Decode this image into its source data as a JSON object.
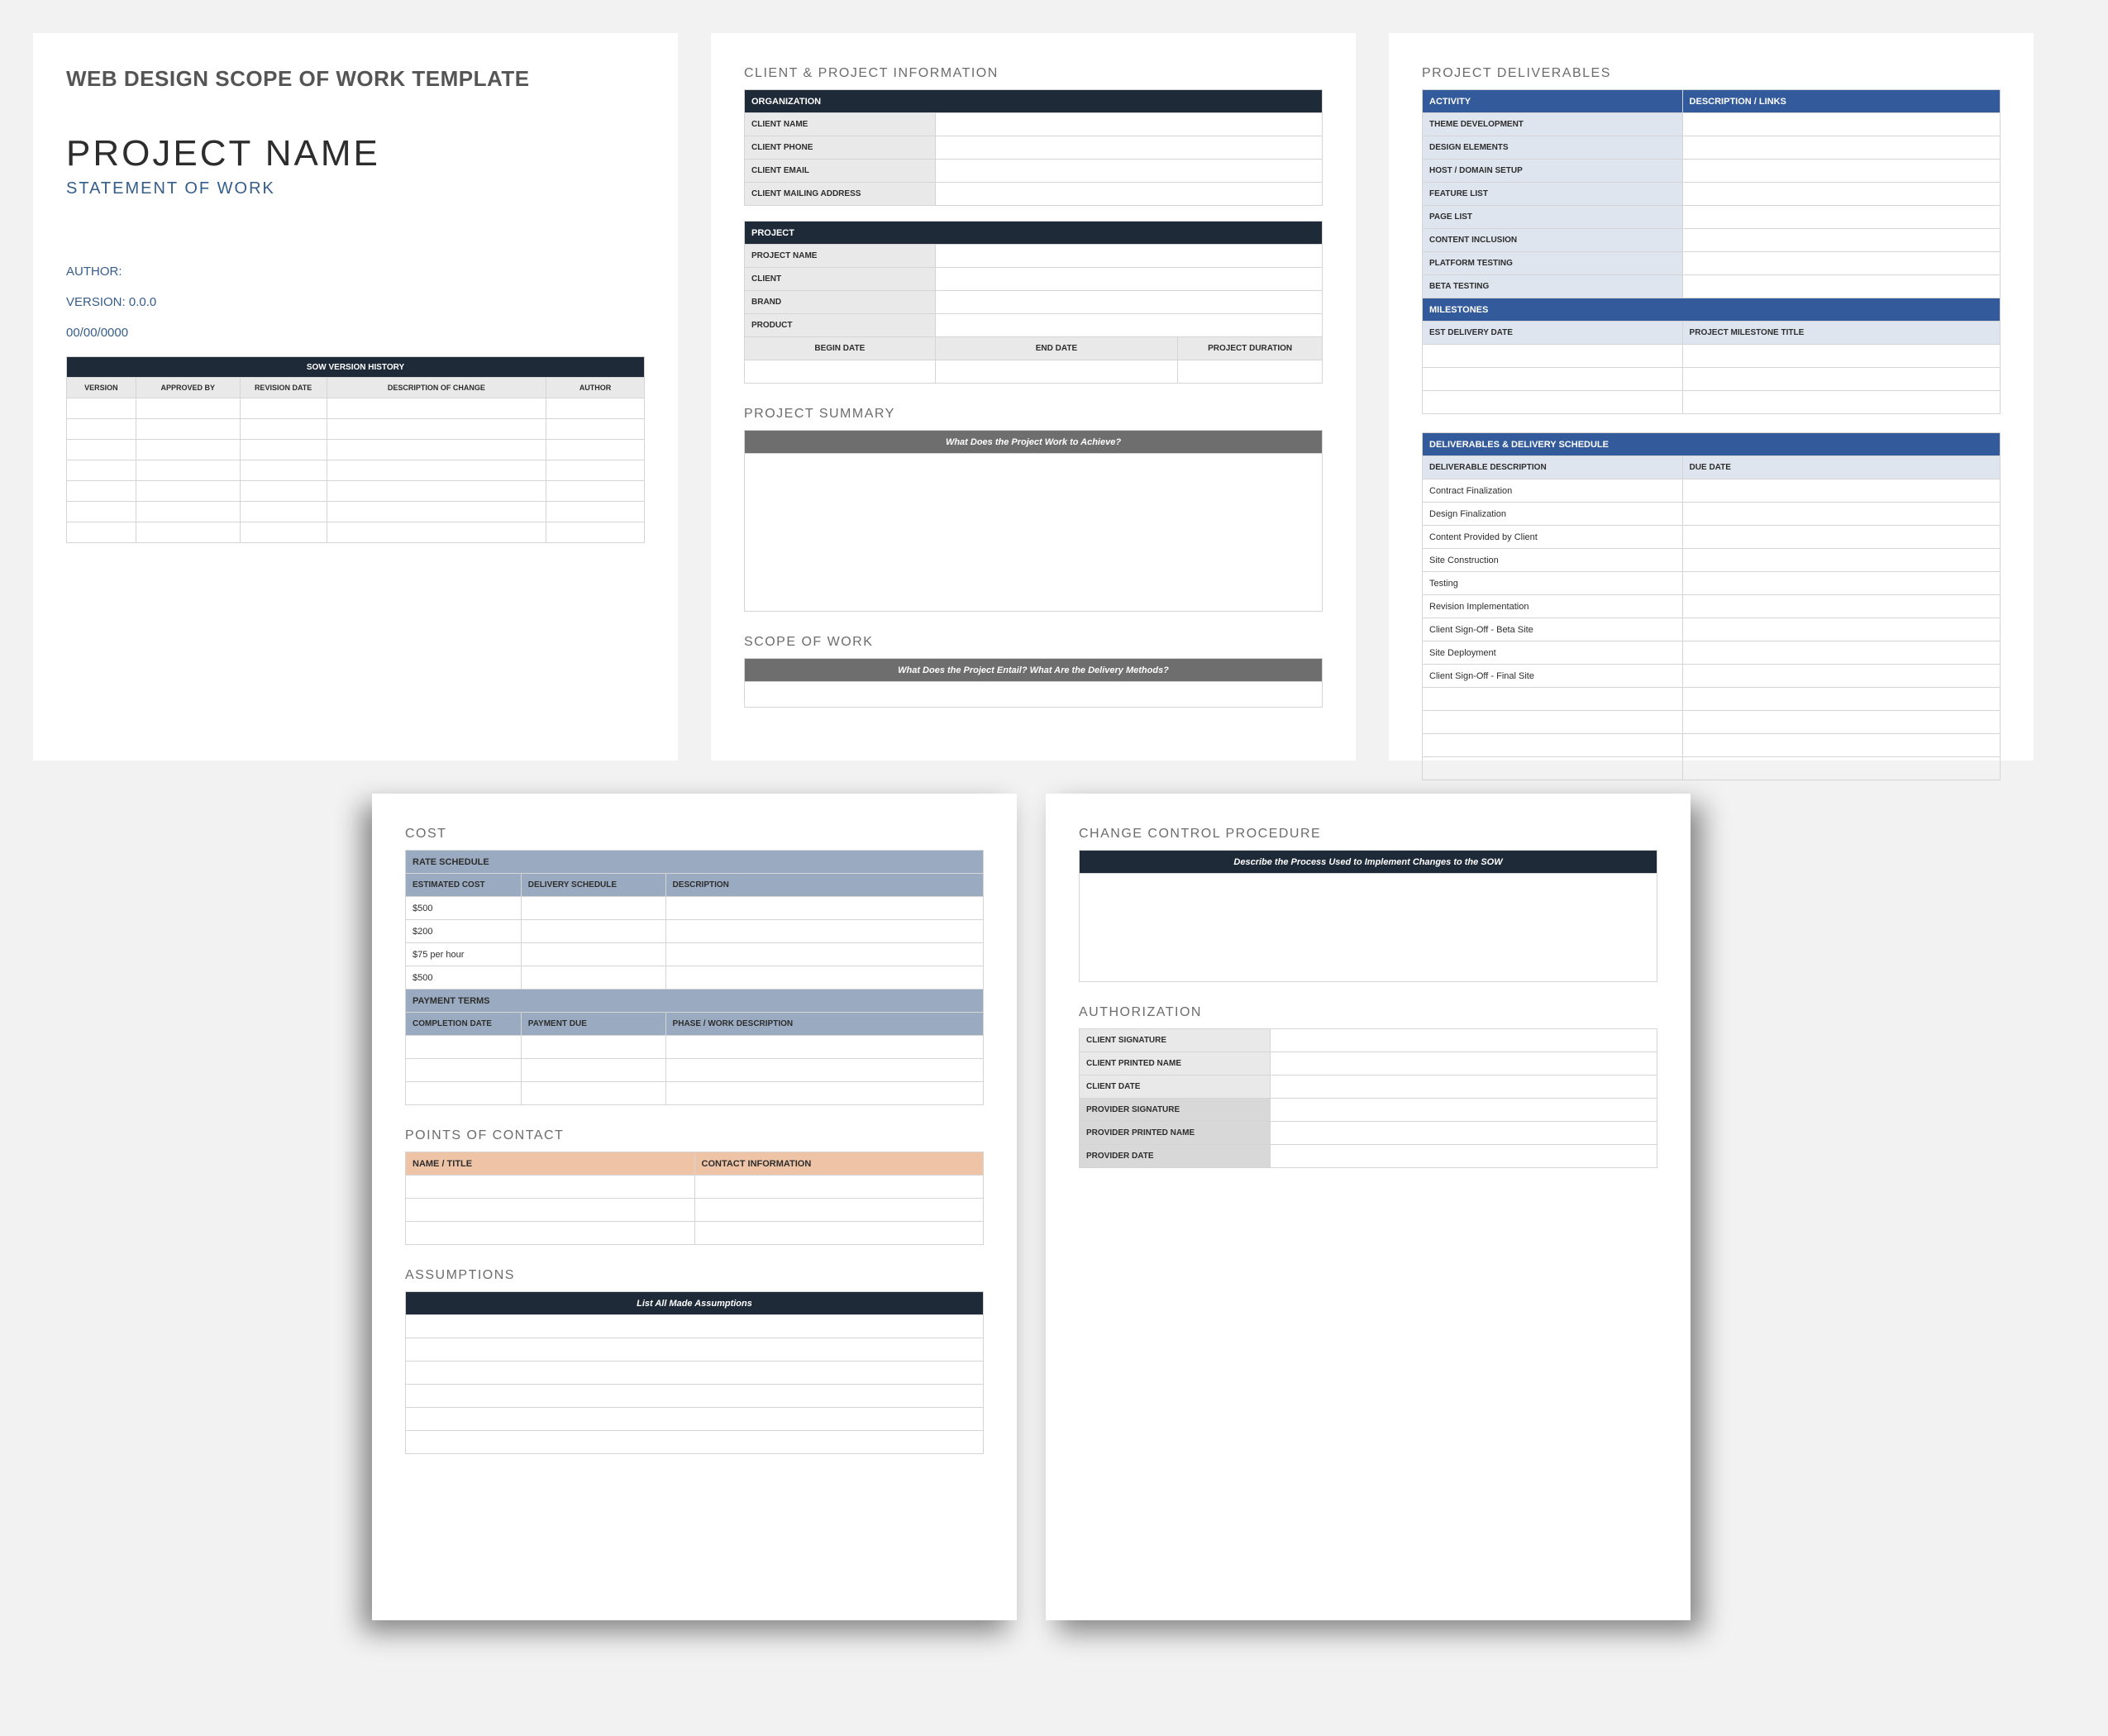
{
  "page1": {
    "template_title": "WEB DESIGN SCOPE OF WORK TEMPLATE",
    "project_name": "PROJECT NAME",
    "subtitle": "STATEMENT OF WORK",
    "author_label": "AUTHOR:",
    "version_label": "VERSION: 0.0.0",
    "date_label": "00/00/0000",
    "history": {
      "title": "SOW VERSION HISTORY",
      "cols": [
        "VERSION",
        "APPROVED BY",
        "REVISION DATE",
        "DESCRIPTION OF CHANGE",
        "AUTHOR"
      ]
    }
  },
  "page2": {
    "sec1": "CLIENT & PROJECT INFORMATION",
    "org_bar": "ORGANIZATION",
    "org_rows": [
      "CLIENT NAME",
      "CLIENT  PHONE",
      "CLIENT EMAIL",
      "CLIENT MAILING ADDRESS"
    ],
    "proj_bar": "PROJECT",
    "proj_rows": [
      "PROJECT NAME",
      "CLIENT",
      "BRAND",
      "PRODUCT"
    ],
    "date_cols": [
      "BEGIN DATE",
      "END DATE",
      "PROJECT DURATION"
    ],
    "sec2": "PROJECT SUMMARY",
    "summary_q": "What Does the Project Work to Achieve?",
    "sec3": "SCOPE OF WORK",
    "scope_q": "What Does the Project Entail? What Are the Delivery Methods?"
  },
  "page3": {
    "sec1": "PROJECT DELIVERABLES",
    "act_cols": [
      "ACTIVITY",
      "DESCRIPTION / LINKS"
    ],
    "activities": [
      "THEME DEVELOPMENT",
      "DESIGN ELEMENTS",
      "HOST / DOMAIN SETUP",
      "FEATURE LIST",
      "PAGE LIST",
      "CONTENT INCLUSION",
      "PLATFORM TESTING",
      "BETA TESTING"
    ],
    "milestones_bar": "MILESTONES",
    "mile_cols": [
      "EST DELIVERY DATE",
      "PROJECT MILESTONE TITLE"
    ],
    "dds_bar": "DELIVERABLES & DELIVERY SCHEDULE",
    "dds_cols": [
      "DELIVERABLE DESCRIPTION",
      "DUE DATE"
    ],
    "dds_rows": [
      "Contract Finalization",
      "Design Finalization",
      "Content Provided by Client",
      "Site Construction",
      "Testing",
      "Revision Implementation",
      "Client Sign-Off - Beta Site",
      "Site Deployment",
      "Client Sign-Off - Final Site"
    ]
  },
  "page4": {
    "sec1": "COST",
    "rate_bar": "RATE SCHEDULE",
    "rate_cols": [
      "ESTIMATED COST",
      "DELIVERY SCHEDULE",
      "DESCRIPTION"
    ],
    "rate_rows": [
      "$500",
      "$200",
      "$75 per hour",
      "$500"
    ],
    "pay_bar": "PAYMENT TERMS",
    "pay_cols": [
      "COMPLETION DATE",
      "PAYMENT DUE",
      "PHASE / WORK DESCRIPTION"
    ],
    "sec2": "POINTS OF CONTACT",
    "poc_cols": [
      "NAME / TITLE",
      "CONTACT INFORMATION"
    ],
    "sec3": "ASSUMPTIONS",
    "assump_q": "List All Made Assumptions"
  },
  "page5": {
    "sec1": "CHANGE CONTROL PROCEDURE",
    "ccp_q": "Describe the Process Used to Implement Changes to the SOW",
    "sec2": "AUTHORIZATION",
    "auth_client": [
      "CLIENT SIGNATURE",
      "CLIENT PRINTED NAME",
      "CLIENT DATE"
    ],
    "auth_prov": [
      "PROVIDER SIGNATURE",
      "PROVIDER PRINTED NAME",
      "PROVIDER DATE"
    ]
  }
}
